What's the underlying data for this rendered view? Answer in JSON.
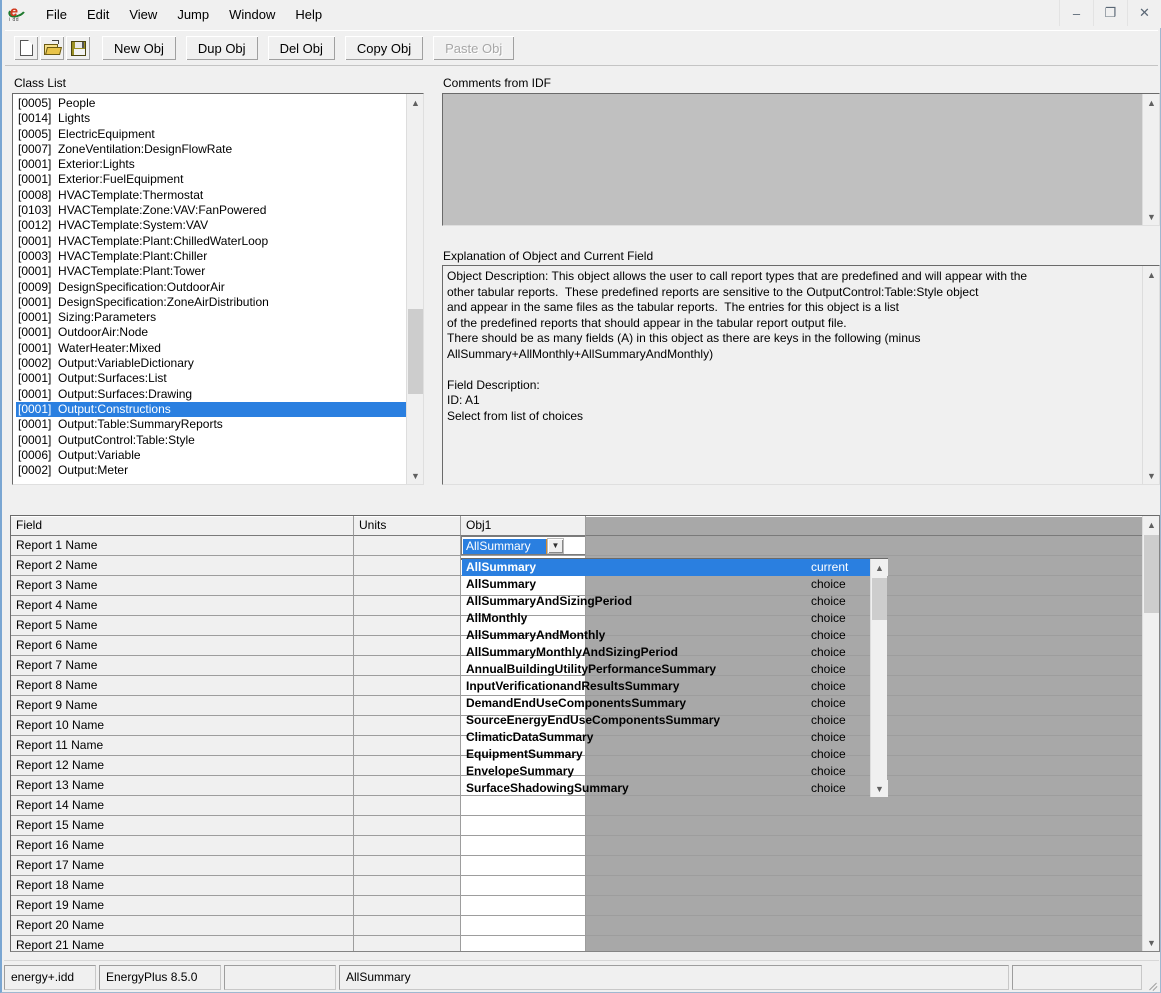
{
  "app": {
    "logo_icon": "energyplus-idd-icon",
    "logo_sub": "i dd"
  },
  "menubar": {
    "items": [
      "File",
      "Edit",
      "View",
      "Jump",
      "Window",
      "Help"
    ]
  },
  "window_controls": {
    "minimize": "–",
    "restore": "❐",
    "close": "✕"
  },
  "toolbar": {
    "icon_buttons": [
      {
        "name": "new-file-icon",
        "label": ""
      },
      {
        "name": "open-file-icon",
        "label": ""
      },
      {
        "name": "save-file-icon",
        "label": ""
      }
    ],
    "buttons": [
      {
        "label": "New Obj",
        "disabled": false
      },
      {
        "label": "Dup Obj",
        "disabled": false
      },
      {
        "label": "Del Obj",
        "disabled": false
      },
      {
        "label": "Copy Obj",
        "disabled": false
      },
      {
        "label": "Paste Obj",
        "disabled": true
      }
    ]
  },
  "labels": {
    "class_list": "Class List",
    "comments": "Comments from IDF",
    "explanation": "Explanation of Object and Current Field"
  },
  "class_list": {
    "selected_index": 20,
    "items": [
      {
        "count": "[0005]",
        "name": "People"
      },
      {
        "count": "[0014]",
        "name": "Lights"
      },
      {
        "count": "[0005]",
        "name": "ElectricEquipment"
      },
      {
        "count": "[0007]",
        "name": "ZoneVentilation:DesignFlowRate"
      },
      {
        "count": "[0001]",
        "name": "Exterior:Lights"
      },
      {
        "count": "[0001]",
        "name": "Exterior:FuelEquipment"
      },
      {
        "count": "[0008]",
        "name": "HVACTemplate:Thermostat"
      },
      {
        "count": "[0103]",
        "name": "HVACTemplate:Zone:VAV:FanPowered"
      },
      {
        "count": "[0012]",
        "name": "HVACTemplate:System:VAV"
      },
      {
        "count": "[0001]",
        "name": "HVACTemplate:Plant:ChilledWaterLoop"
      },
      {
        "count": "[0003]",
        "name": "HVACTemplate:Plant:Chiller"
      },
      {
        "count": "[0001]",
        "name": "HVACTemplate:Plant:Tower"
      },
      {
        "count": "[0009]",
        "name": "DesignSpecification:OutdoorAir"
      },
      {
        "count": "[0001]",
        "name": "DesignSpecification:ZoneAirDistribution"
      },
      {
        "count": "[0001]",
        "name": "Sizing:Parameters"
      },
      {
        "count": "[0001]",
        "name": "OutdoorAir:Node"
      },
      {
        "count": "[0001]",
        "name": "WaterHeater:Mixed"
      },
      {
        "count": "[0002]",
        "name": "Output:VariableDictionary"
      },
      {
        "count": "[0001]",
        "name": "Output:Surfaces:List"
      },
      {
        "count": "[0001]",
        "name": "Output:Surfaces:Drawing"
      },
      {
        "count": "[0001]",
        "name": "Output:Constructions"
      },
      {
        "count": "[0001]",
        "name": "Output:Table:SummaryReports"
      },
      {
        "count": "[0001]",
        "name": "OutputControl:Table:Style"
      },
      {
        "count": "[0006]",
        "name": "Output:Variable"
      },
      {
        "count": "[0002]",
        "name": "Output:Meter"
      }
    ]
  },
  "comments": {
    "value": ""
  },
  "explanation": {
    "text": "Object Description: This object allows the user to call report types that are predefined and will appear with the\nother tabular reports.  These predefined reports are sensitive to the OutputControl:Table:Style object\nand appear in the same files as the tabular reports.  The entries for this object is a list\nof the predefined reports that should appear in the tabular report output file.\nThere should be as many fields (A) in this object as there are keys in the following (minus\nAllSummary+AllMonthly+AllSummaryAndMonthly)\n\nField Description:\nID: A1\nSelect from list of choices"
  },
  "grid": {
    "headers": [
      "Field",
      "Units",
      "Obj1"
    ],
    "rows": [
      {
        "field": "Report 1 Name",
        "units": "",
        "obj1": "AllSummary"
      },
      {
        "field": "Report 2 Name",
        "units": "",
        "obj1": ""
      },
      {
        "field": "Report 3 Name",
        "units": "",
        "obj1": ""
      },
      {
        "field": "Report 4 Name",
        "units": "",
        "obj1": ""
      },
      {
        "field": "Report 5 Name",
        "units": "",
        "obj1": ""
      },
      {
        "field": "Report 6 Name",
        "units": "",
        "obj1": ""
      },
      {
        "field": "Report 7 Name",
        "units": "",
        "obj1": ""
      },
      {
        "field": "Report 8 Name",
        "units": "",
        "obj1": ""
      },
      {
        "field": "Report 9 Name",
        "units": "",
        "obj1": ""
      },
      {
        "field": "Report 10 Name",
        "units": "",
        "obj1": ""
      },
      {
        "field": "Report 11 Name",
        "units": "",
        "obj1": ""
      },
      {
        "field": "Report 12 Name",
        "units": "",
        "obj1": ""
      },
      {
        "field": "Report 13 Name",
        "units": "",
        "obj1": ""
      },
      {
        "field": "Report 14 Name",
        "units": "",
        "obj1": ""
      },
      {
        "field": "Report 15 Name",
        "units": "",
        "obj1": ""
      },
      {
        "field": "Report 16 Name",
        "units": "",
        "obj1": ""
      },
      {
        "field": "Report 17 Name",
        "units": "",
        "obj1": ""
      },
      {
        "field": "Report 18 Name",
        "units": "",
        "obj1": ""
      },
      {
        "field": "Report 19 Name",
        "units": "",
        "obj1": ""
      },
      {
        "field": "Report 20 Name",
        "units": "",
        "obj1": ""
      },
      {
        "field": "Report 21 Name",
        "units": "",
        "obj1": ""
      }
    ]
  },
  "combobox": {
    "value": "AllSummary",
    "arrow_icon": "chevron-down-icon"
  },
  "dropdown": {
    "selected_index": 0,
    "options": [
      {
        "label": "AllSummary",
        "kind": "current"
      },
      {
        "label": "AllSummary",
        "kind": "choice"
      },
      {
        "label": "AllSummaryAndSizingPeriod",
        "kind": "choice"
      },
      {
        "label": "AllMonthly",
        "kind": "choice"
      },
      {
        "label": "AllSummaryAndMonthly",
        "kind": "choice"
      },
      {
        "label": "AllSummaryMonthlyAndSizingPeriod",
        "kind": "choice"
      },
      {
        "label": "AnnualBuildingUtilityPerformanceSummary",
        "kind": "choice"
      },
      {
        "label": "InputVerificationandResultsSummary",
        "kind": "choice"
      },
      {
        "label": "DemandEndUseComponentsSummary",
        "kind": "choice"
      },
      {
        "label": "SourceEnergyEndUseComponentsSummary",
        "kind": "choice"
      },
      {
        "label": "ClimaticDataSummary",
        "kind": "choice"
      },
      {
        "label": "EquipmentSummary",
        "kind": "choice"
      },
      {
        "label": "EnvelopeSummary",
        "kind": "choice"
      },
      {
        "label": "SurfaceShadowingSummary",
        "kind": "choice"
      }
    ]
  },
  "statusbar": {
    "idd_file": "energy+.idd",
    "version": "EnergyPlus 8.5.0",
    "panel3": "",
    "current_value": "AllSummary",
    "panel5": ""
  },
  "colors": {
    "selection_blue": "#2a7fe0",
    "window_face": "#f0f0f0",
    "grid_fill": "#a8a8a8",
    "comments_disabled": "#c0c0c0"
  }
}
